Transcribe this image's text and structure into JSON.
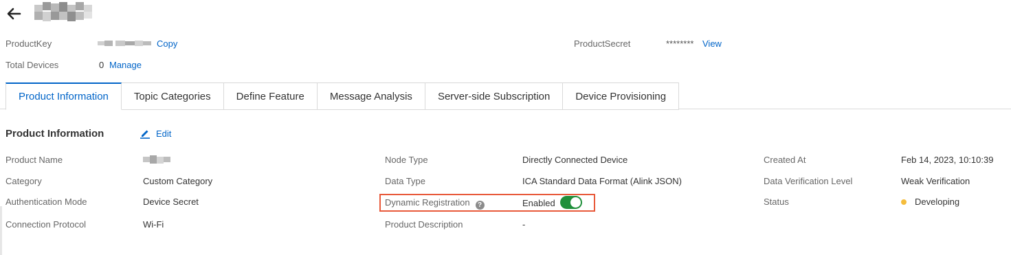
{
  "header": {
    "back_icon": "arrow-left-icon"
  },
  "meta": {
    "product_key_label": "ProductKey",
    "copy_label": "Copy",
    "product_secret_label": "ProductSecret",
    "product_secret_value": "********",
    "view_label": "View",
    "total_devices_label": "Total Devices",
    "total_devices_value": "0",
    "manage_label": "Manage"
  },
  "tabs": [
    {
      "label": "Product Information",
      "active": true
    },
    {
      "label": "Topic Categories",
      "active": false
    },
    {
      "label": "Define Feature",
      "active": false
    },
    {
      "label": "Message Analysis",
      "active": false
    },
    {
      "label": "Server-side Subscription",
      "active": false
    },
    {
      "label": "Device Provisioning",
      "active": false
    }
  ],
  "section": {
    "title": "Product Information",
    "edit_label": "Edit"
  },
  "info": {
    "product_name_label": "Product Name",
    "category_label": "Category",
    "category_value": "Custom Category",
    "auth_mode_label": "Authentication Mode",
    "auth_mode_value": "Device Secret",
    "protocol_label": "Connection Protocol",
    "protocol_value": "Wi-Fi",
    "node_type_label": "Node Type",
    "node_type_value": "Directly Connected Device",
    "data_type_label": "Data Type",
    "data_type_value": "ICA Standard Data Format (Alink JSON)",
    "dynamic_reg_label": "Dynamic Registration",
    "dynamic_reg_value": "Enabled",
    "dynamic_reg_on": true,
    "product_desc_label": "Product Description",
    "product_desc_value": "-",
    "created_at_label": "Created At",
    "created_at_value": "Feb 14, 2023, 10:10:39",
    "verification_label": "Data Verification Level",
    "verification_value": "Weak Verification",
    "status_label": "Status",
    "status_value": "Developing"
  },
  "colors": {
    "link": "#0064c8",
    "highlight_border": "#e8593a",
    "toggle_on": "#1f8f3a",
    "status_dot": "#f5bd3c"
  }
}
